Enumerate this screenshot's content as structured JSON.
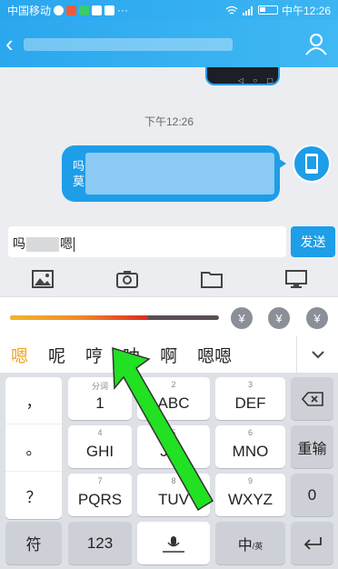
{
  "status_bar": {
    "carrier": "中国移动",
    "time": "中午12:26",
    "icons": [
      "chat-icon",
      "app-icon",
      "video-icon",
      "image-icon",
      "qq-icon",
      "more-icon"
    ]
  },
  "header": {
    "back_label": "",
    "title": "",
    "profile_icon": "person-icon"
  },
  "chat": {
    "timestamp": "下午12:26",
    "bubble_line1": "吗",
    "bubble_line2": "莫"
  },
  "input": {
    "prefix": "吗",
    "suffix": "嗯"
  },
  "send_label": "发送",
  "toolbar": [
    "image-icon",
    "camera-icon",
    "folder-icon",
    "monitor-icon"
  ],
  "ime": {
    "progress": 0.66,
    "yuan": [
      "¥",
      "¥",
      "¥"
    ],
    "candidates": [
      "嗯",
      "呢",
      "哼",
      "呐",
      "啊",
      "嗯嗯"
    ]
  },
  "keyboard": {
    "punct": [
      "，",
      "。",
      "？"
    ],
    "keys": [
      {
        "sub": "分词",
        "main": "1"
      },
      {
        "sub": "2",
        "main": "ABC"
      },
      {
        "sub": "3",
        "main": "DEF"
      },
      {
        "sub": "4",
        "main": "GHI"
      },
      {
        "sub": "5",
        "main": "JKL"
      },
      {
        "sub": "6",
        "main": "MNO"
      },
      {
        "sub": "7",
        "main": "PQRS"
      },
      {
        "sub": "8",
        "main": "TUV"
      },
      {
        "sub": "9",
        "main": "WXYZ"
      }
    ],
    "reenter": "重输",
    "zero": "0",
    "symbol": "符",
    "num": "123",
    "lang_main": "中",
    "lang_sub": "/英"
  },
  "colors": {
    "accent": "#1e9de8",
    "candidate_highlight": "#f2a21a",
    "arrow": "#22e022"
  }
}
